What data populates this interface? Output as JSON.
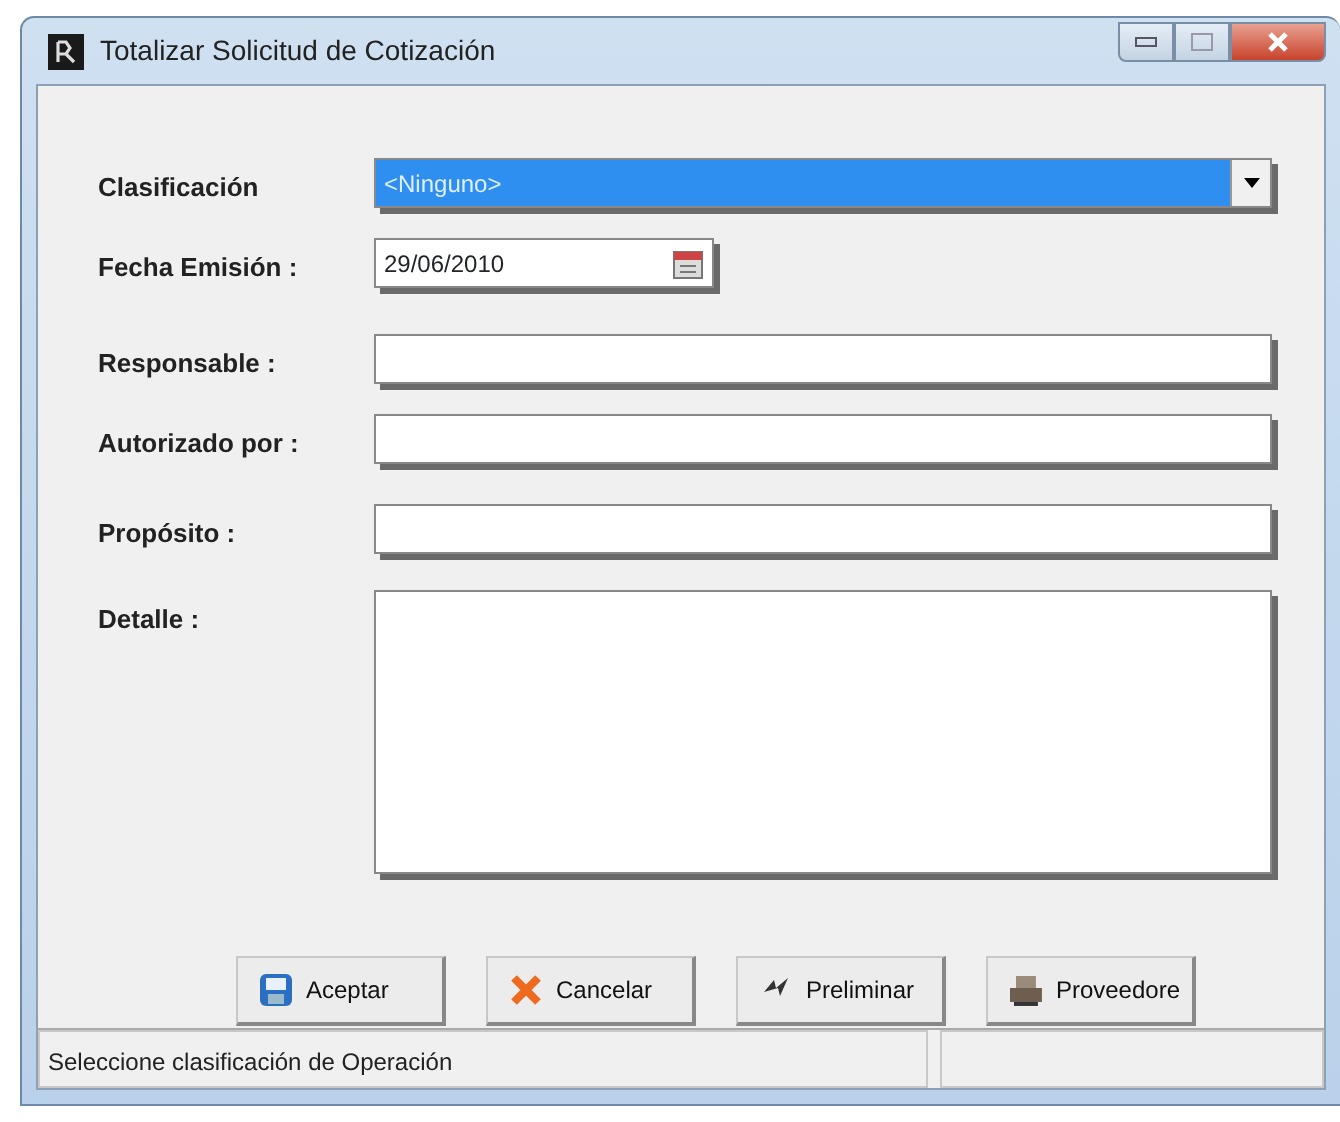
{
  "window": {
    "title": "Totalizar Solicitud de Cotización"
  },
  "fields": [
    {
      "kind": "dropdown",
      "label": "Clasificación",
      "value": "<Ninguno>",
      "highlighted": true
    },
    {
      "kind": "date",
      "label": "Fecha Emisión :",
      "value": "29/06/2010"
    },
    {
      "kind": "text",
      "label": "Responsable :"
    },
    {
      "kind": "text",
      "label": "Autorizado por :"
    },
    {
      "kind": "text",
      "label": "Propósito :"
    },
    {
      "kind": "memo",
      "label": "Detalle :"
    }
  ],
  "buttons": [
    {
      "kind": "accept",
      "label": "Aceptar"
    },
    {
      "kind": "cancel",
      "label": "Cancelar"
    },
    {
      "kind": "preview",
      "label": "Preliminar"
    },
    {
      "kind": "suppliers",
      "label": "Proveedore"
    }
  ],
  "status_bar": {
    "message": "Seleccione clasificación de Operación"
  }
}
